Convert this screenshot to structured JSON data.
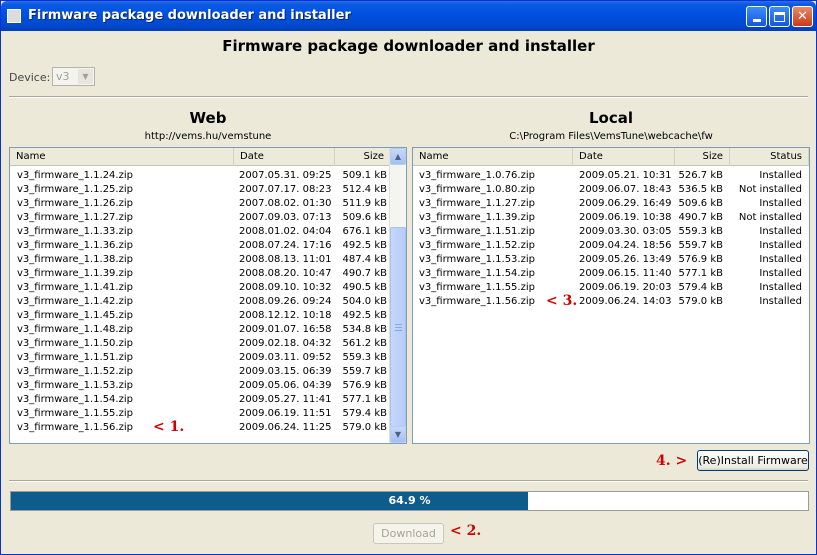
{
  "window": {
    "title": "Firmware package downloader and installer"
  },
  "heading": "Firmware package downloader and installer",
  "device": {
    "label": "Device:",
    "value": "v3"
  },
  "web": {
    "title": "Web",
    "url": "http://vems.hu/vemstune",
    "columns": [
      "Name",
      "Date",
      "Size"
    ],
    "rows": [
      [
        "v3_firmware_1.1.24.zip",
        "2007.05.31. 09:25",
        "509.1 kB"
      ],
      [
        "v3_firmware_1.1.25.zip",
        "2007.07.17. 08:23",
        "512.4 kB"
      ],
      [
        "v3_firmware_1.1.26.zip",
        "2007.08.02. 01:30",
        "511.9 kB"
      ],
      [
        "v3_firmware_1.1.27.zip",
        "2007.09.03. 07:13",
        "509.6 kB"
      ],
      [
        "v3_firmware_1.1.33.zip",
        "2008.01.02. 04:04",
        "676.1 kB"
      ],
      [
        "v3_firmware_1.1.36.zip",
        "2008.07.24. 17:16",
        "492.5 kB"
      ],
      [
        "v3_firmware_1.1.38.zip",
        "2008.08.13. 11:01",
        "487.4 kB"
      ],
      [
        "v3_firmware_1.1.39.zip",
        "2008.08.20. 10:47",
        "490.7 kB"
      ],
      [
        "v3_firmware_1.1.41.zip",
        "2008.09.10. 10:32",
        "490.5 kB"
      ],
      [
        "v3_firmware_1.1.42.zip",
        "2008.09.26. 09:24",
        "504.0 kB"
      ],
      [
        "v3_firmware_1.1.45.zip",
        "2008.12.12. 10:18",
        "492.5 kB"
      ],
      [
        "v3_firmware_1.1.48.zip",
        "2009.01.07. 16:58",
        "534.8 kB"
      ],
      [
        "v3_firmware_1.1.50.zip",
        "2009.02.18. 04:32",
        "561.2 kB"
      ],
      [
        "v3_firmware_1.1.51.zip",
        "2009.03.11. 09:52",
        "559.3 kB"
      ],
      [
        "v3_firmware_1.1.52.zip",
        "2009.03.15. 06:39",
        "559.7 kB"
      ],
      [
        "v3_firmware_1.1.53.zip",
        "2009.05.06. 04:39",
        "576.9 kB"
      ],
      [
        "v3_firmware_1.1.54.zip",
        "2009.05.27. 11:41",
        "577.1 kB"
      ],
      [
        "v3_firmware_1.1.55.zip",
        "2009.06.19. 11:51",
        "579.4 kB"
      ],
      [
        "v3_firmware_1.1.56.zip",
        "2009.06.24. 11:25",
        "579.0 kB"
      ]
    ],
    "marker": "< 1."
  },
  "local": {
    "title": "Local",
    "path": "C:\\Program Files\\VemsTune\\webcache\\fw",
    "columns": [
      "Name",
      "Date",
      "Size",
      "Status"
    ],
    "rows": [
      [
        "v3_firmware_1.0.76.zip",
        "2009.05.21. 10:31",
        "526.7 kB",
        "Installed"
      ],
      [
        "v3_firmware_1.0.80.zip",
        "2009.06.07. 18:43",
        "536.5 kB",
        "Not installed"
      ],
      [
        "v3_firmware_1.1.27.zip",
        "2009.06.29. 16:49",
        "509.6 kB",
        "Installed"
      ],
      [
        "v3_firmware_1.1.39.zip",
        "2009.06.19. 10:38",
        "490.7 kB",
        "Not installed"
      ],
      [
        "v3_firmware_1.1.51.zip",
        "2009.03.30. 03:05",
        "559.3 kB",
        "Installed"
      ],
      [
        "v3_firmware_1.1.52.zip",
        "2009.04.24. 18:56",
        "559.7 kB",
        "Installed"
      ],
      [
        "v3_firmware_1.1.53.zip",
        "2009.05.26. 13:49",
        "576.9 kB",
        "Installed"
      ],
      [
        "v3_firmware_1.1.54.zip",
        "2009.06.15. 11:40",
        "577.1 kB",
        "Installed"
      ],
      [
        "v3_firmware_1.1.55.zip",
        "2009.06.19. 20:03",
        "579.4 kB",
        "Installed"
      ],
      [
        "v3_firmware_1.1.56.zip",
        "2009.06.24. 14:03",
        "579.0 kB",
        "Installed"
      ]
    ],
    "marker": "< 3."
  },
  "install": {
    "label": "(Re)Install Firmware",
    "marker": "4. >"
  },
  "progress": {
    "value": 64.9,
    "text": "64.9 %"
  },
  "download": {
    "label": "Download",
    "marker": "< 2."
  },
  "colors": {
    "titlebar": "#0052e3",
    "progress_fill": "#0e5c8b",
    "marker": "#d00000"
  }
}
